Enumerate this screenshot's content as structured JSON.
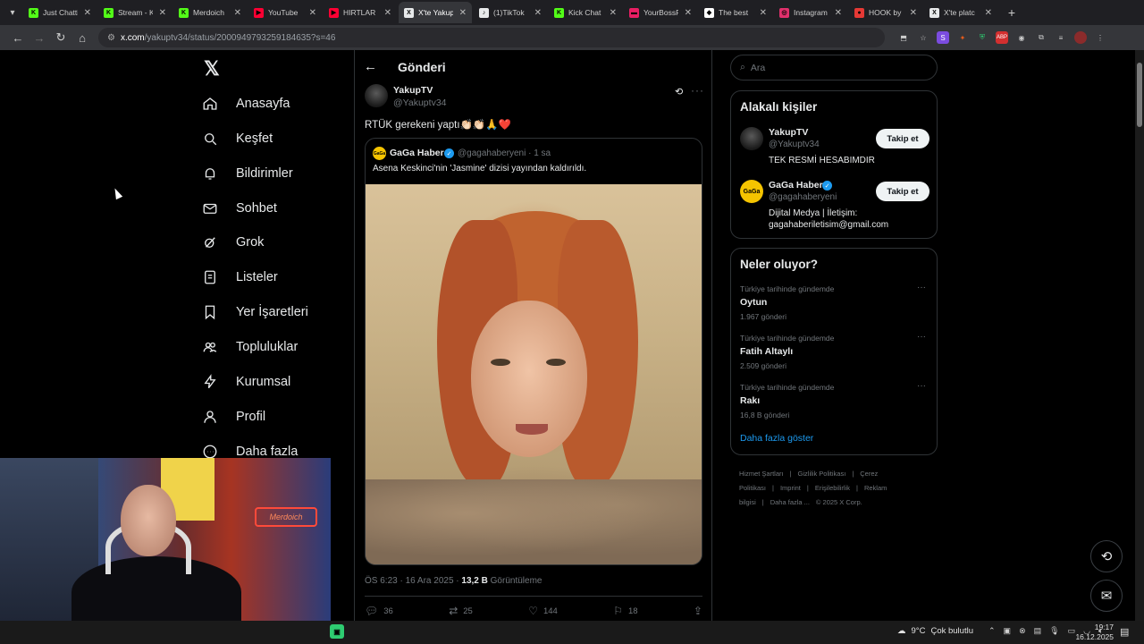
{
  "browser": {
    "tabs": [
      {
        "title": "Just Chatti",
        "favicon_color": "#53fc18",
        "favicon_glyph": "K"
      },
      {
        "title": "Stream - K",
        "favicon_color": "#53fc18",
        "favicon_glyph": "K"
      },
      {
        "title": "Merdoich",
        "favicon_color": "#53fc18",
        "favicon_glyph": "K"
      },
      {
        "title": "YouTube",
        "favicon_color": "#ff0033",
        "favicon_glyph": "▶"
      },
      {
        "title": "HIRTLAR",
        "favicon_color": "#ff0033",
        "favicon_glyph": "▶"
      },
      {
        "title": "X'te Yakup",
        "favicon_color": "#e7e9ea",
        "favicon_glyph": "X",
        "active": true
      },
      {
        "title": "(1)TikTok",
        "favicon_color": "#e7e9ea",
        "favicon_glyph": "♪"
      },
      {
        "title": "Kick Chat",
        "favicon_color": "#53fc18",
        "favicon_glyph": "K"
      },
      {
        "title": "YourBossF",
        "favicon_color": "#e91e63",
        "favicon_glyph": "▬"
      },
      {
        "title": "The best",
        "favicon_color": "#ffffff",
        "favicon_glyph": "◆"
      },
      {
        "title": "Instagram",
        "favicon_color": "#e1306c",
        "favicon_glyph": "◎"
      },
      {
        "title": "HOOK by",
        "favicon_color": "#e53935",
        "favicon_glyph": "●"
      },
      {
        "title": "X'te platc",
        "favicon_color": "#e7e9ea",
        "favicon_glyph": "X"
      }
    ],
    "url_host": "x.com",
    "url_path": "/yakuptv34/status/2000949793259184635?s=46"
  },
  "x_logo": "𝕏",
  "nav": [
    {
      "label": "Anasayfa",
      "icon": "home-icon"
    },
    {
      "label": "Keşfet",
      "icon": "search-icon"
    },
    {
      "label": "Bildirimler",
      "icon": "bell-icon"
    },
    {
      "label": "Sohbet",
      "icon": "mail-icon"
    },
    {
      "label": "Grok",
      "icon": "grok-icon"
    },
    {
      "label": "Listeler",
      "icon": "list-icon"
    },
    {
      "label": "Yer İşaretleri",
      "icon": "bookmark-icon"
    },
    {
      "label": "Topluluklar",
      "icon": "people-icon"
    },
    {
      "label": "Kurumsal",
      "icon": "bolt-icon"
    },
    {
      "label": "Profil",
      "icon": "user-icon"
    },
    {
      "label": "Daha fazla",
      "icon": "more-circle-icon"
    }
  ],
  "post": {
    "header_title": "Gönderi",
    "author_name": "YakupTV",
    "author_handle": "@Yakuptv34",
    "text": "RTÜK gerekeni yaptı👏🏻👏🏻🙏❤️",
    "quote": {
      "avatar_text": "GaGa",
      "name": "GaGa Haber",
      "handle_time": "@gagahaberyeni · 1 sa",
      "text": "Asena Keskinci'nin 'Jasmine' dizisi yayından kaldırıldı."
    },
    "meta_time": "ÖS 6:23 · 16 Ara 2025 · ",
    "views_count": "13,2 B",
    "views_label": " Görüntüleme",
    "replies": "36",
    "reposts": "25",
    "likes": "144",
    "bookmarks": "18"
  },
  "right": {
    "search_placeholder": "Ara",
    "related_title": "Alakalı kişiler",
    "people": [
      {
        "name": "YakupTV",
        "handle": "@Yakuptv34",
        "bio": "TEK RESMİ HESABIMDIR",
        "follow_label": "Takip et"
      },
      {
        "name": "GaGa Haber",
        "handle": "@gagahaberyeni",
        "bio": "Dijital Medya | İletişim: gagahaberiletisim@gmail.com",
        "follow_label": "Takip et",
        "avatar_text": "GaGa"
      }
    ],
    "trends_title": "Neler oluyor?",
    "trends": [
      {
        "context": "Türkiye tarihinde gündemde",
        "name": "Oytun",
        "count": "1.967 gönderi"
      },
      {
        "context": "Türkiye tarihinde gündemde",
        "name": "Fatih Altaylı",
        "count": "2.509 gönderi"
      },
      {
        "context": "Türkiye tarihinde gündemde",
        "name": "Rakı",
        "count": "16,8 B gönderi"
      }
    ],
    "show_more": "Daha fazla göster",
    "footer": [
      "Hizmet Şartları",
      "|",
      "Gizlilik Politikası",
      "|",
      "Çerez Politikası",
      "|",
      "Imprint",
      "|",
      "Erişilebilirlik",
      "|",
      "Reklam bilgisi",
      "|",
      "Daha fazla ...",
      "© 2025 X Corp."
    ]
  },
  "webcam_neon": "Merdoich",
  "taskbar": {
    "weather_temp": "9°C",
    "weather_text": "Çok bulutlu",
    "time": "19:17",
    "date": "16.12.2025"
  },
  "colors": {
    "accent": "#1d9bf0",
    "background": "#000000",
    "border": "#2f3336",
    "muted": "#71767b"
  }
}
